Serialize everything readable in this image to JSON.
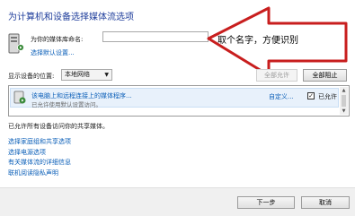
{
  "window": {
    "title": "为计算机和设备选择媒体流选项"
  },
  "library": {
    "name_label": "为你的媒体库命名:",
    "name_value": "",
    "set_default_link": "选择默认设置..."
  },
  "annotation": {
    "text": "取个名字，方便识别"
  },
  "filter": {
    "label": "显示设备的位置:",
    "selected": "本地网络",
    "allow_all": "全部允许",
    "block_all": "全部阻止"
  },
  "devices": [
    {
      "name": "该电脑上和远程连接上的媒体程序...",
      "subtitle": "已允许使用默认设置访问。",
      "customize": "自定义...",
      "allowed_label": "已允许",
      "allowed": true
    }
  ],
  "status_text": "已允许所有设备访问你的共享媒体。",
  "links": [
    "选择家庭组和共享选项",
    "选择电源选项",
    "有关媒体流的详细信息",
    "联机阅读隐私声明"
  ],
  "footer": {
    "next": "下一步",
    "cancel": "取消"
  },
  "colors": {
    "title": "#1e3d9b",
    "link": "#0b5fb8",
    "arrow": "#c81e1e"
  }
}
